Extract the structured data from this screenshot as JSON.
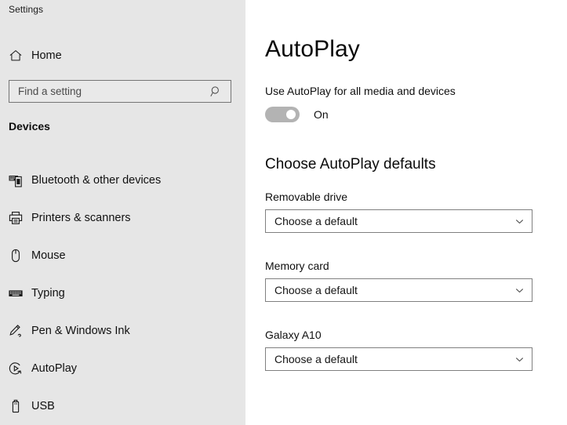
{
  "window": {
    "app_title": "Settings"
  },
  "sidebar": {
    "home": {
      "label": "Home",
      "icon": "home-icon"
    },
    "search": {
      "value": "",
      "placeholder": "Find a setting",
      "icon": "search-icon"
    },
    "section_title": "Devices",
    "items": [
      {
        "label": "Bluetooth & other devices",
        "icon": "bluetooth-devices-icon",
        "selected": false
      },
      {
        "label": "Printers & scanners",
        "icon": "printer-icon",
        "selected": false
      },
      {
        "label": "Mouse",
        "icon": "mouse-icon",
        "selected": false
      },
      {
        "label": "Typing",
        "icon": "keyboard-icon",
        "selected": false
      },
      {
        "label": "Pen & Windows Ink",
        "icon": "pen-icon",
        "selected": false
      },
      {
        "label": "AutoPlay",
        "icon": "autoplay-icon",
        "selected": true
      },
      {
        "label": "USB",
        "icon": "usb-icon",
        "selected": false
      }
    ]
  },
  "main": {
    "page_title": "AutoPlay",
    "toggle": {
      "caption": "Use AutoPlay for all media and devices",
      "state_label": "On",
      "checked": true
    },
    "subsection_title": "Choose AutoPlay defaults",
    "fields": [
      {
        "label": "Removable drive",
        "value": "Choose a default"
      },
      {
        "label": "Memory card",
        "value": "Choose a default"
      },
      {
        "label": "Galaxy A10",
        "value": "Choose a default"
      }
    ]
  },
  "colors": {
    "sidebar_bg": "#e6e6e6",
    "main_bg": "#ffffff",
    "text": "#0f0f0f",
    "border": "#808080",
    "toggle_track": "#b3b3b3"
  }
}
